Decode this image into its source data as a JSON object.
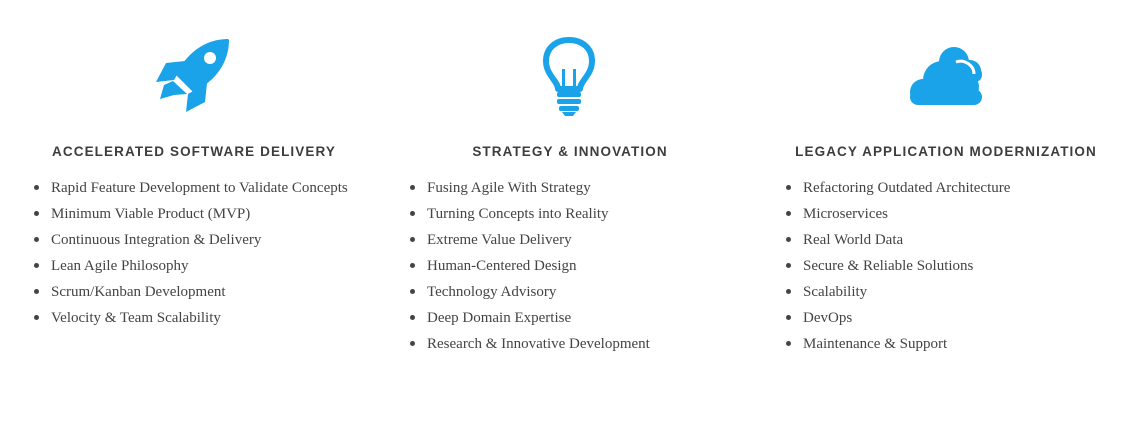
{
  "accent_color": "#1aa3e8",
  "columns": [
    {
      "icon": "rocket-icon",
      "heading": "ACCELERATED SOFTWARE DELIVERY",
      "items": [
        "Rapid Feature Development to Validate Concepts",
        "Minimum Viable Product (MVP)",
        "Continuous Integration & Delivery",
        "Lean Agile Philosophy",
        "Scrum/Kanban Development",
        "Velocity & Team Scalability"
      ]
    },
    {
      "icon": "lightbulb-icon",
      "heading": "STRATEGY & INNOVATION",
      "items": [
        "Fusing Agile With Strategy",
        "Turning Concepts into Reality",
        "Extreme Value Delivery",
        "Human-Centered Design",
        "Technology Advisory",
        "Deep Domain Expertise",
        "Research & Innovative Development"
      ]
    },
    {
      "icon": "cloud-icon",
      "heading": "LEGACY APPLICATION MODERNIZATION",
      "items": [
        "Refactoring Outdated Architecture",
        "Microservices",
        "Real World Data",
        "Secure & Reliable Solutions",
        "Scalability",
        "DevOps",
        "Maintenance & Support"
      ]
    }
  ]
}
